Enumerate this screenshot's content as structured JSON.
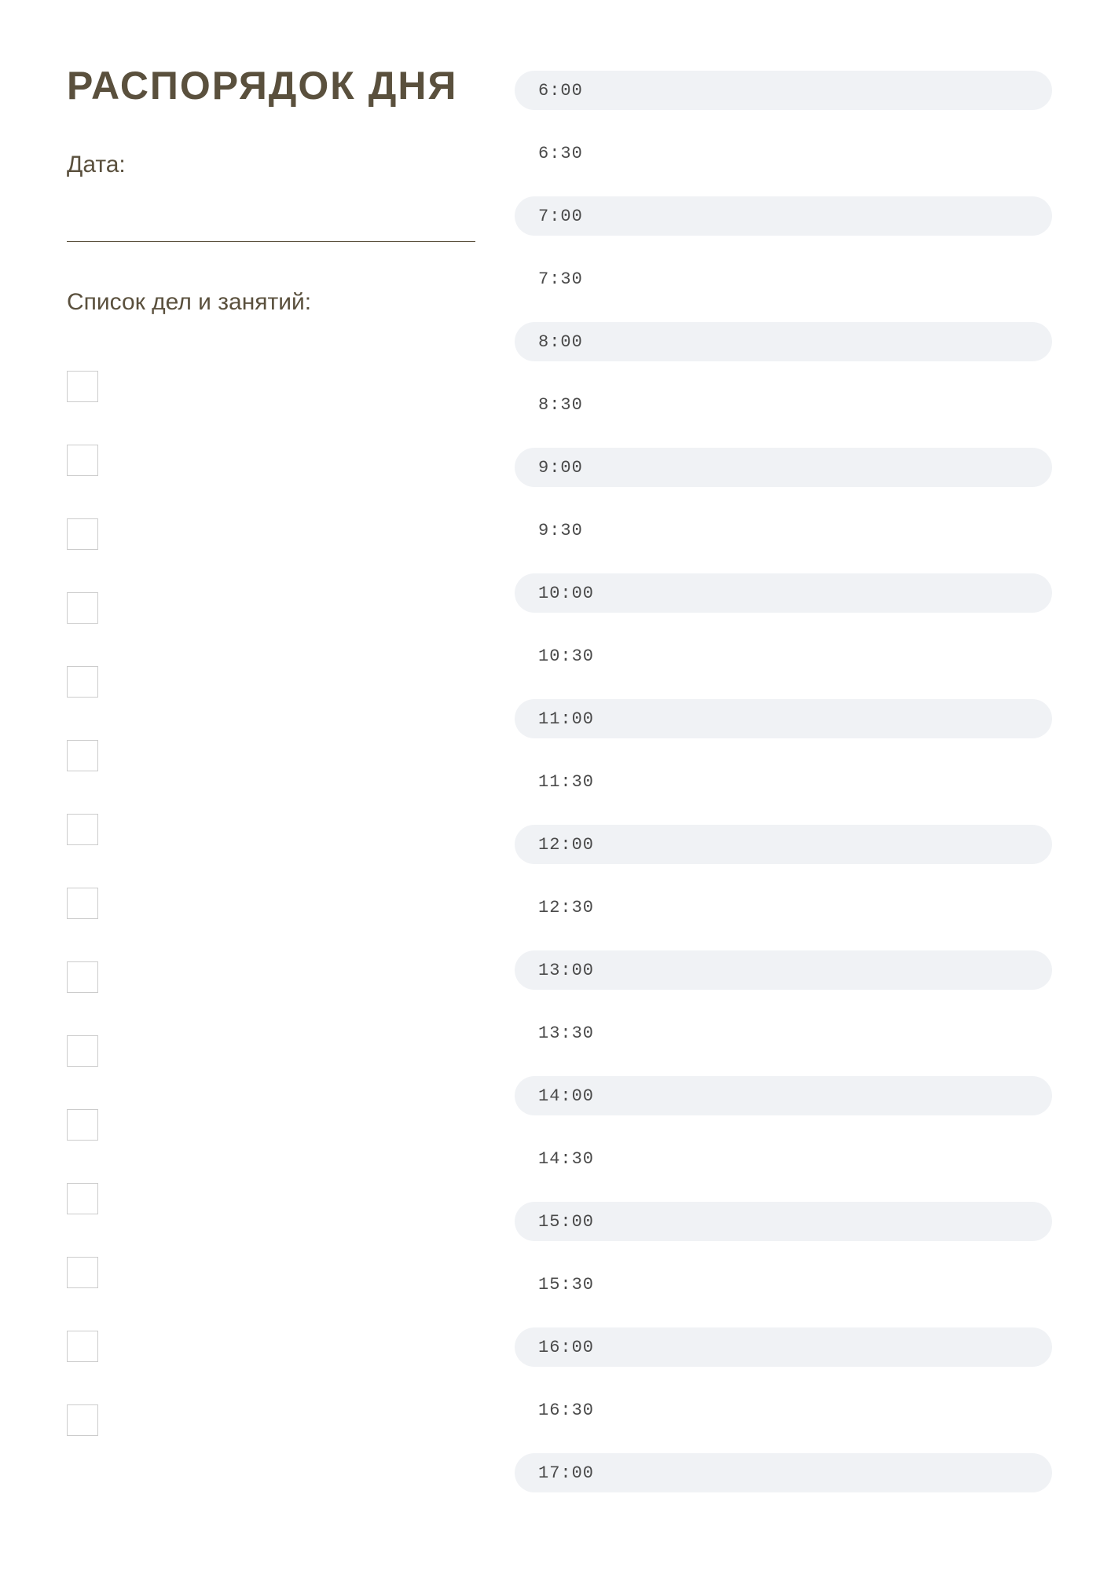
{
  "header": {
    "title": "РАСПОРЯДОК ДНЯ",
    "date_label": "Дата:",
    "tasks_label": "Список дел и занятий:"
  },
  "checkbox_count": 15,
  "time_slots": [
    {
      "time": "6:00",
      "shaded": true
    },
    {
      "time": "6:30",
      "shaded": false
    },
    {
      "time": "7:00",
      "shaded": true
    },
    {
      "time": "7:30",
      "shaded": false
    },
    {
      "time": "8:00",
      "shaded": true
    },
    {
      "time": "8:30",
      "shaded": false
    },
    {
      "time": "9:00",
      "shaded": true
    },
    {
      "time": "9:30",
      "shaded": false
    },
    {
      "time": "10:00",
      "shaded": true
    },
    {
      "time": "10:30",
      "shaded": false
    },
    {
      "time": "11:00",
      "shaded": true
    },
    {
      "time": "11:30",
      "shaded": false
    },
    {
      "time": "12:00",
      "shaded": true
    },
    {
      "time": "12:30",
      "shaded": false
    },
    {
      "time": "13:00",
      "shaded": true
    },
    {
      "time": "13:30",
      "shaded": false
    },
    {
      "time": "14:00",
      "shaded": true
    },
    {
      "time": "14:30",
      "shaded": false
    },
    {
      "time": "15:00",
      "shaded": true
    },
    {
      "time": "15:30",
      "shaded": false
    },
    {
      "time": "16:00",
      "shaded": true
    },
    {
      "time": "16:30",
      "shaded": false
    },
    {
      "time": "17:00",
      "shaded": true
    }
  ]
}
